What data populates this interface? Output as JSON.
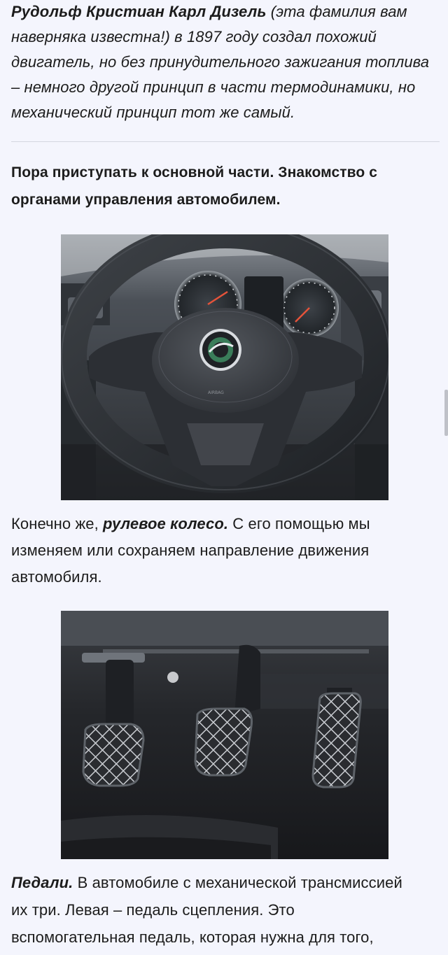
{
  "intro": {
    "name": "Рудольф Кристиан Карл Дизель",
    "line1_rest": " (эта фамилия вам",
    "line2": "наверняка известна!) в 1897 году создал похожий",
    "line3": "двигатель, но без принудительного зажигания топлива",
    "line4": "– немного другой принцип в части термодинамики, но",
    "line5": "механический принцип тот же самый."
  },
  "section_heading": {
    "line1": "Пора приступать к основной части. Знакомство с",
    "line2": "органами управления автомобилем."
  },
  "wheel_photo": {
    "airbag_text": "AIRBAG"
  },
  "steering_caption": {
    "prefix": "Конечно же, ",
    "term": "рулевое колесо.",
    "line1_rest": " С его помощью мы",
    "line2": "изменяем или сохраняем направление движения",
    "line3": "автомобиля."
  },
  "pedals_caption": {
    "term": "Педали.",
    "line1_rest": " В автомобиле с механической трансмиссией",
    "line2": "их три. Левая – педаль сцепления. Это",
    "line3": "вспомогательная педаль, которая нужна для того,"
  },
  "colors": {
    "background": "#f4f5fd",
    "text": "#1c1c1c",
    "divider": "#d4d6e0"
  }
}
